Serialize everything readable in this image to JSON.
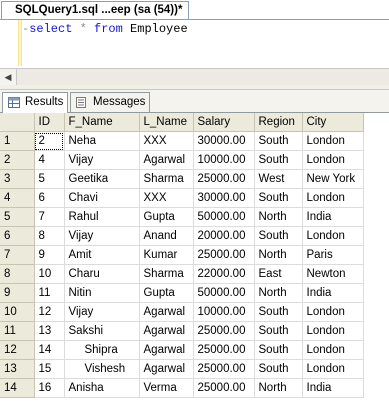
{
  "document_tab": {
    "title": "SQLQuery1.sql ...eep (sa (54))*"
  },
  "editor": {
    "keyword_select": "select",
    "star": "*",
    "keyword_from": "from",
    "table_name": "Employee"
  },
  "results_tabs": [
    {
      "label": "Results",
      "active": true,
      "icon": "grid-icon"
    },
    {
      "label": "Messages",
      "active": false,
      "icon": "messages-icon"
    }
  ],
  "grid": {
    "columns": [
      "ID",
      "F_Name",
      "L_Name",
      "Salary",
      "Region",
      "City"
    ],
    "rows": [
      [
        "1",
        "2",
        "Neha",
        "XXX",
        "30000.00",
        "South",
        "London"
      ],
      [
        "2",
        "4",
        "Vijay",
        "Agarwal",
        "10000.00",
        "South",
        "London"
      ],
      [
        "3",
        "5",
        "Geetika",
        "Sharma",
        "25000.00",
        "West",
        "New York"
      ],
      [
        "4",
        "6",
        "Chavi",
        "XXX",
        "30000.00",
        "South",
        "London"
      ],
      [
        "5",
        "7",
        "Rahul",
        "Gupta",
        "50000.00",
        "North",
        "India"
      ],
      [
        "6",
        "8",
        "Vijay",
        "Anand",
        "20000.00",
        "South",
        "London"
      ],
      [
        "7",
        "9",
        "Amit",
        "Kumar",
        "25000.00",
        "North",
        "Paris"
      ],
      [
        "8",
        "10",
        "Charu",
        "Sharma",
        "22000.00",
        "East",
        "Newton"
      ],
      [
        "9",
        "11",
        "Nitin",
        "Gupta",
        "50000.00",
        "North",
        "India"
      ],
      [
        "10",
        "12",
        "Vijay",
        "Agarwal",
        "10000.00",
        "South",
        "London"
      ],
      [
        "11",
        "13",
        "Sakshi",
        "Agarwal",
        "25000.00",
        "South",
        "London"
      ],
      [
        "12",
        "14",
        "     Shipra",
        "Agarwal",
        "25000.00",
        "South",
        "London"
      ],
      [
        "13",
        "15",
        "     Vishesh",
        "Agarwal",
        "25000.00",
        "South",
        "London"
      ],
      [
        "14",
        "16",
        "Anisha",
        "Verma",
        "25000.00",
        "North",
        "India"
      ]
    ]
  }
}
